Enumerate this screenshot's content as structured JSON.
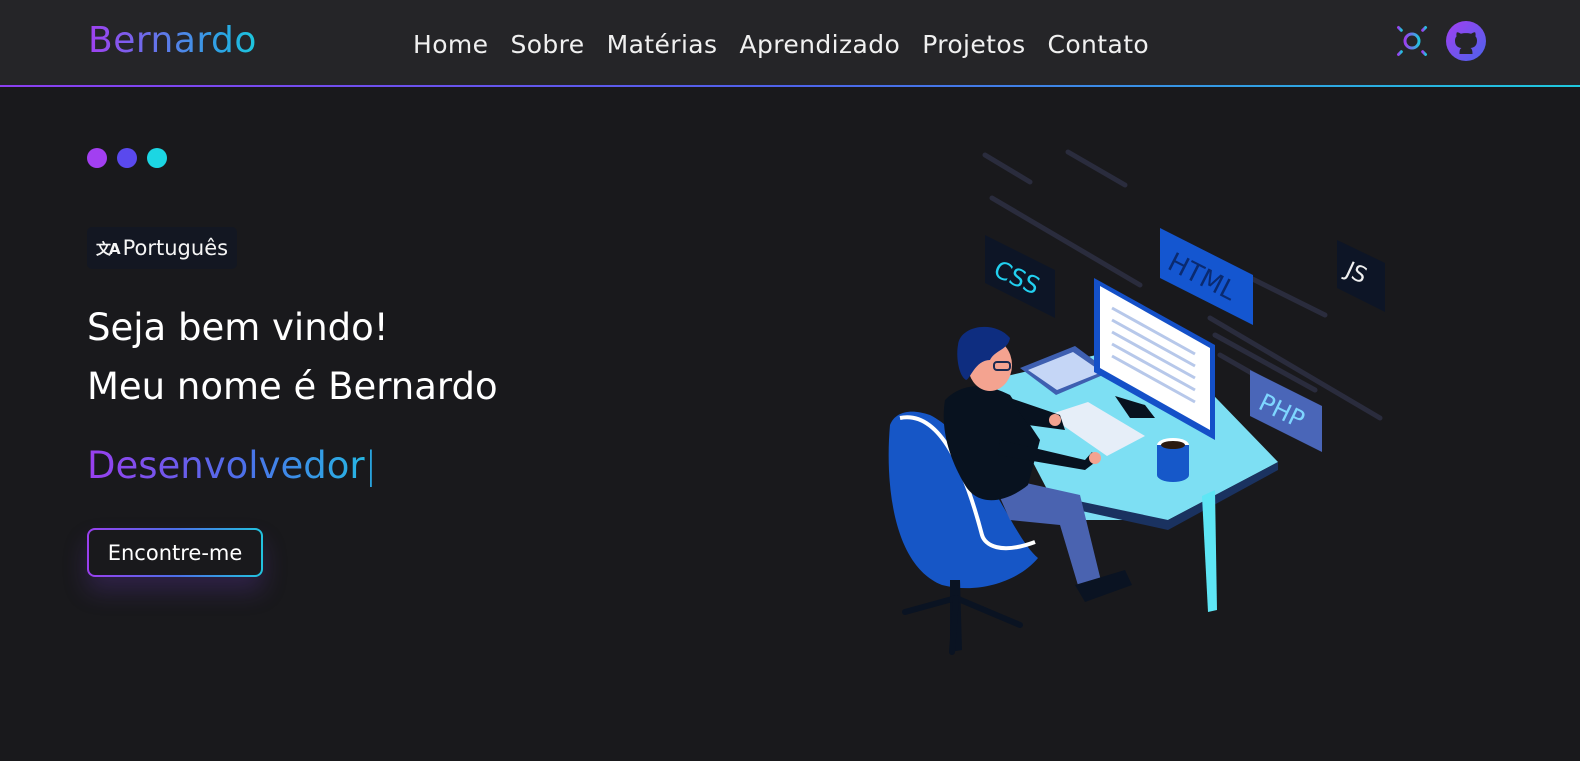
{
  "header": {
    "brand": "Bernardo",
    "nav": [
      "Home",
      "Sobre",
      "Matérias",
      "Aprendizado",
      "Projetos",
      "Contato"
    ],
    "theme_toggle_icon": "sun-icon",
    "github_icon": "github-icon"
  },
  "hero": {
    "dot_colors": [
      "#a23ff1",
      "#5a49ee",
      "#1cd6e3"
    ],
    "language_button": "Português",
    "language_icon": "translate-icon",
    "greeting_line1": "Seja bem vindo!",
    "greeting_line2": "Meu nome é Bernardo",
    "role": "Desenvolvedor",
    "cursor": "|",
    "cta_label": "Encontre-me"
  },
  "illustration": {
    "tags": [
      "CSS",
      "HTML",
      "JS",
      "PHP"
    ]
  },
  "colors": {
    "background": "#19191c",
    "header": "#252528",
    "accent_purple": "#9a3fef",
    "accent_cyan": "#1fc9de"
  }
}
